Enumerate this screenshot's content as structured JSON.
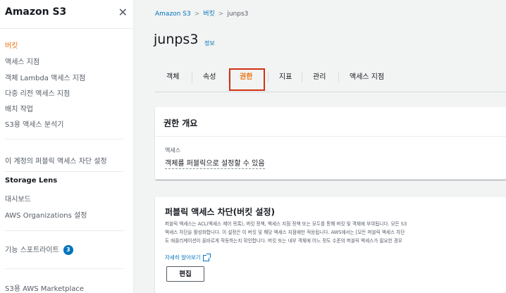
{
  "sidebar": {
    "title": "Amazon S3",
    "close_glyph": "✕",
    "items": [
      {
        "label": "버킷",
        "active": true
      },
      {
        "label": "액세스 지점"
      },
      {
        "label": "객체 Lambda 액세스 지점"
      },
      {
        "label": "다중 리전 액세스 지점"
      },
      {
        "label": "배치 작업"
      },
      {
        "label": "S3용 액세스 분석기"
      }
    ],
    "account_block": "이 계정의 퍼블릭 액세스 차단 설정",
    "storage_lens": {
      "heading": "Storage Lens",
      "items": [
        {
          "label": "대시보드"
        },
        {
          "label": "AWS Organizations 설정"
        }
      ]
    },
    "feature_spotlight": {
      "label": "기능 스포트라이트",
      "badge": "3"
    },
    "marketplace": "S3용 AWS Marketplace"
  },
  "breadcrumb": {
    "items": [
      "Amazon S3",
      "버킷",
      "junps3"
    ],
    "separator": ">"
  },
  "page": {
    "title": "junps3",
    "info_link": "정보"
  },
  "tabs": [
    {
      "label": "객체"
    },
    {
      "label": "속성"
    },
    {
      "label": "권한",
      "active": true
    },
    {
      "label": "지표"
    },
    {
      "label": "관리"
    },
    {
      "label": "액세스 지점"
    }
  ],
  "permissions_overview": {
    "title": "권한 개요",
    "access_label": "액세스",
    "access_value": "객체를 퍼블릭으로 설정할 수 있음"
  },
  "block_public_access": {
    "title": "퍼블릭 액세스 차단(버킷 설정)",
    "description_lines": [
      "퍼블릭 액세스는 ACL(액세스 제어 목록), 버킷 정책, 액세스 지점 정책 또는 모두를 통해 버킷 및 객체에 부여됩니다. 모든 S3",
      "액세스 차단을 활성화합니다. 이 설정은 이 버킷 및 해당 액세스 지점에만 적용됩니다. AWS에서는 [모든 퍼블릭 액세스 차단",
      "도 애플리케이션이 올바르게 작동하는지 확인합니다. 버킷 또는 내부 객체에 어느 정도 수준의 퍼블릭 액세스가 필요한 경우"
    ],
    "learn_more": "자세히 알아보기",
    "edit_button": "편집"
  },
  "colors": {
    "accent_orange": "#ec7211",
    "link_blue": "#0073bb",
    "highlight_red": "#d13212",
    "badge_blue": "#0073bb"
  }
}
